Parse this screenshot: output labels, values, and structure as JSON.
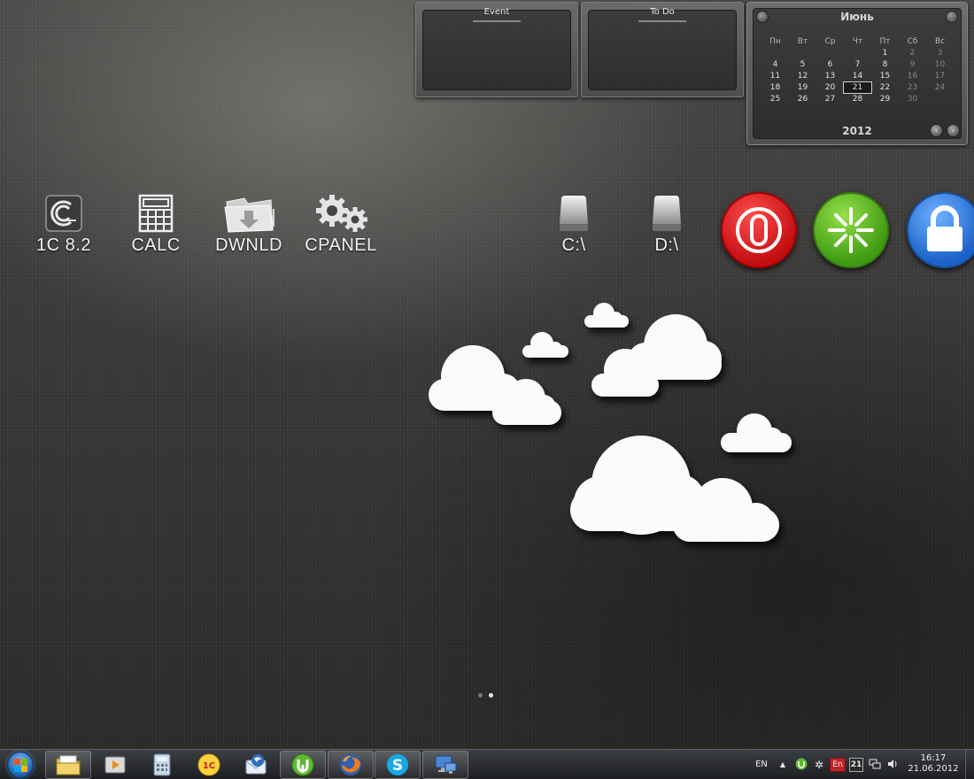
{
  "gadgets": {
    "event": {
      "title": "Event"
    },
    "todo": {
      "title": "To Do"
    },
    "calendar": {
      "month": "Июнь",
      "year": "2012",
      "weekdays": [
        "Пн",
        "Вт",
        "Ср",
        "Чт",
        "Пт",
        "Сб",
        "Вс"
      ],
      "weeks": [
        [
          "",
          "",
          "",
          "",
          "1",
          "2",
          "3"
        ],
        [
          "4",
          "5",
          "6",
          "7",
          "8",
          "9",
          "10"
        ],
        [
          "11",
          "12",
          "13",
          "14",
          "15",
          "16",
          "17"
        ],
        [
          "18",
          "19",
          "20",
          "21",
          "22",
          "23",
          "24"
        ],
        [
          "25",
          "26",
          "27",
          "28",
          "29",
          "30",
          ""
        ]
      ],
      "today": "21"
    }
  },
  "desktop": {
    "icons": [
      {
        "name": "1c-icon",
        "label": "1C 8.2"
      },
      {
        "name": "calc-icon",
        "label": "CALC"
      },
      {
        "name": "download-folder-icon",
        "label": "DWNLD"
      },
      {
        "name": "gears-icon",
        "label": "CPANEL"
      },
      {
        "name": "drive-icon",
        "label": "C:\\"
      },
      {
        "name": "drive-icon",
        "label": "D:\\"
      }
    ],
    "buttons": [
      {
        "name": "power-icon",
        "color": "#d01a1c"
      },
      {
        "name": "restart-icon",
        "color": "#4aa51a"
      },
      {
        "name": "lock-icon",
        "color": "#2a73d8"
      }
    ],
    "page_indicator": {
      "pages": 2,
      "active": 2
    }
  },
  "taskbar": {
    "apps": [
      {
        "name": "windows-explorer-icon",
        "open": true
      },
      {
        "name": "media-player-icon",
        "open": false
      },
      {
        "name": "calculator-icon",
        "open": false
      },
      {
        "name": "1c-enterprise-icon",
        "open": false
      },
      {
        "name": "thunderbird-icon",
        "open": false
      },
      {
        "name": "utorrent-icon",
        "open": true
      },
      {
        "name": "firefox-icon",
        "open": true
      },
      {
        "name": "skype-icon",
        "open": true
      },
      {
        "name": "remote-desktop-icon",
        "open": true
      }
    ],
    "tray": {
      "language": "EN",
      "keyboard_layout": "En",
      "date_badge": "21",
      "time": "16:17",
      "date": "21.06.2012"
    }
  }
}
